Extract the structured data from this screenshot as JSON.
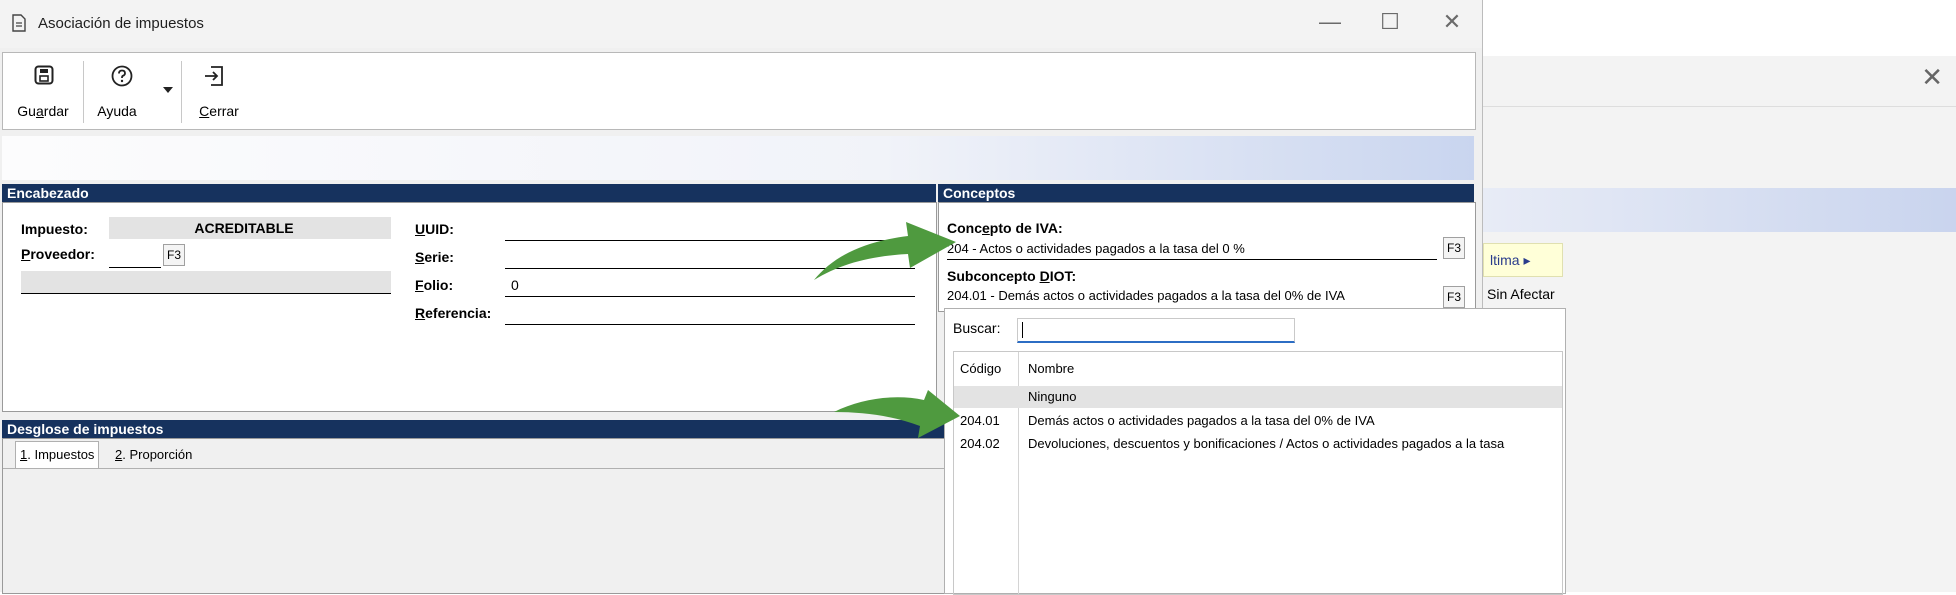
{
  "window": {
    "title": "Asociación de impuestos",
    "controls": {
      "minimize": "—",
      "maximize": "☐",
      "close": "✕"
    }
  },
  "toolbar": {
    "save_label_pre": "Gu",
    "save_label_key": "a",
    "save_label_post": "rdar",
    "help_label": "Ayuda",
    "close_label_key": "C",
    "close_label_post": "errar"
  },
  "encabezado": {
    "header": "Encabezado",
    "impuesto_label": "Impuesto:",
    "impuesto_value": "ACREDITABLE",
    "proveedor_key": "P",
    "proveedor_rest": "roveedor:",
    "proveedor_f3": "F3",
    "uuid_key": "U",
    "uuid_rest": "UID:",
    "serie_key": "S",
    "serie_rest": "erie:",
    "folio_key": "F",
    "folio_rest": "olio:",
    "folio_value": "0",
    "referencia_key": "R",
    "referencia_rest": "eferencia:"
  },
  "conceptos": {
    "header": "Conceptos",
    "iva_label_pre": "Conc",
    "iva_label_key": "e",
    "iva_label_post": "pto de IVA:",
    "iva_value": "204 - Actos o actividades pagados a la tasa del 0 %",
    "iva_f3": "F3",
    "diot_label_pre": "Subconcepto ",
    "diot_label_key": "D",
    "diot_label_post": "IOT:",
    "diot_value": "204.01 - Demás actos o actividades pagados a la tasa del 0% de IVA",
    "diot_f3": "F3"
  },
  "dropdown": {
    "search_label": "Buscar:",
    "search_value": "",
    "columns": {
      "code": "Código",
      "name": "Nombre"
    },
    "rows": [
      {
        "code": "",
        "name": "Ninguno",
        "selected": true
      },
      {
        "code": "204.01",
        "name": "Demás actos o actividades pagados a la tasa del 0% de IVA",
        "selected": false
      },
      {
        "code": "204.02",
        "name": "Devoluciones, descuentos y bonificaciones / Actos o actividades pagados a la tasa",
        "selected": false
      }
    ]
  },
  "desglose": {
    "header": "Desglose de impuestos",
    "tab1_key": "1",
    "tab1_rest": ". Impuestos",
    "tab2_key": "2",
    "tab2_rest": ". Proporción"
  },
  "background_window": {
    "link_text": "ltima ▸",
    "sin_afectar": "Sin Afectar",
    "close": "✕"
  },
  "colors": {
    "section_header": "#16325e",
    "arrow_green": "#4f9a3f",
    "selected_row": "#e3e3e3",
    "search_underline": "#2c6dc4"
  },
  "icons": [
    "document-icon",
    "save-icon",
    "help-icon",
    "dropdown-arrow-icon",
    "exit-icon",
    "green-arrow-icon"
  ]
}
